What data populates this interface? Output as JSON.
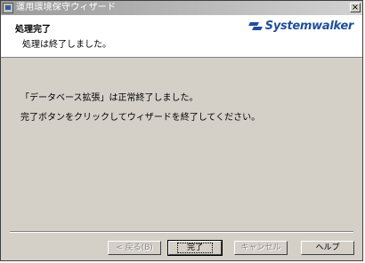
{
  "window": {
    "title": "運用環境保守ウィザード"
  },
  "header": {
    "title": "処理完了",
    "subtitle": "処理は終了しました。",
    "logo_text": "Systemwalker",
    "logo_color": "#1f4e9c"
  },
  "body": {
    "message1": "「データベース拡張」は正常終了しました。",
    "message2": "完了ボタンをクリックしてウィザードを終了してください。"
  },
  "buttons": {
    "back": "< 戻る(B)",
    "finish": "完了",
    "cancel": "キャンセル",
    "help": "ヘルプ"
  },
  "icons": {
    "app": "app-window-icon",
    "close": "close-icon",
    "logo": "systemwalker-logo-icon"
  }
}
